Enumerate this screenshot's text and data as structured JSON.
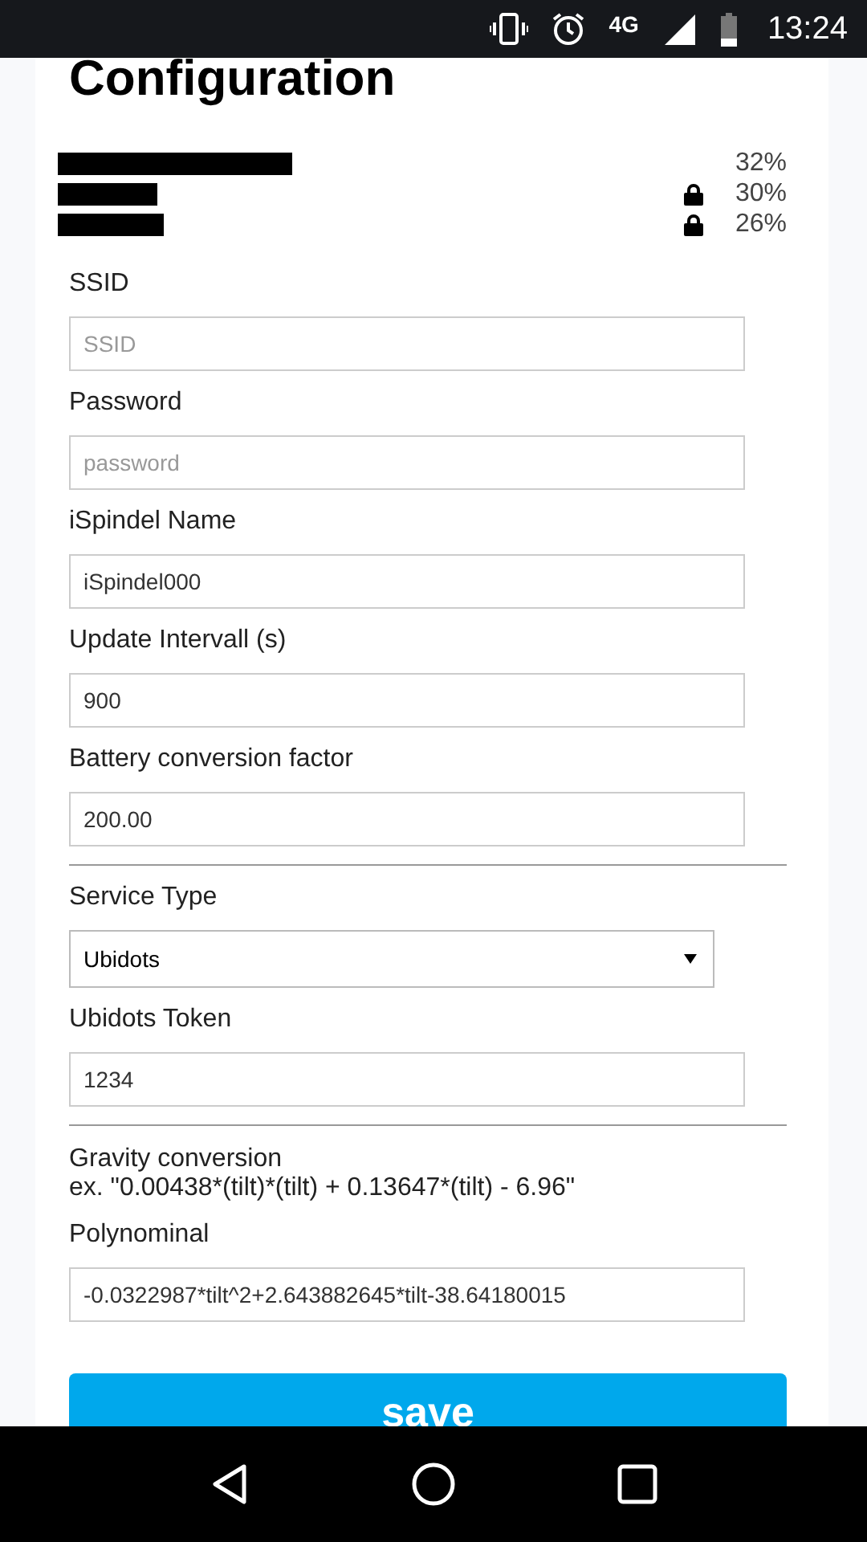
{
  "status_bar": {
    "network": "4G",
    "time": "13:24"
  },
  "title": "Configuration",
  "networks": [
    {
      "locked": false,
      "signal": "32%"
    },
    {
      "locked": true,
      "signal": "30%"
    },
    {
      "locked": true,
      "signal": "26%"
    }
  ],
  "form": [
    {
      "kind": "input",
      "label": "SSID",
      "placeholder": "SSID"
    },
    {
      "kind": "input",
      "label": "Password",
      "placeholder": "password"
    },
    {
      "kind": "input",
      "label": "iSpindel Name",
      "value": "iSpindel000"
    },
    {
      "kind": "input",
      "label": "Update Intervall (s)",
      "value": "900"
    },
    {
      "kind": "input",
      "label": "Battery conversion factor",
      "value": "200.00"
    },
    {
      "kind": "divider"
    },
    {
      "kind": "select",
      "label": "Service Type",
      "value": "Ubidots"
    },
    {
      "kind": "input",
      "label": "Ubidots Token",
      "value": "1234"
    },
    {
      "kind": "divider"
    },
    {
      "kind": "note",
      "lines": [
        "Gravity conversion",
        "ex. \"0.00438*(tilt)*(tilt) + 0.13647*(tilt) - 6.96\""
      ]
    },
    {
      "kind": "input",
      "label": "Polynominal",
      "value": "-0.0322987*tilt^2+2.643882645*tilt-38.64180015"
    }
  ],
  "save_button": "save"
}
